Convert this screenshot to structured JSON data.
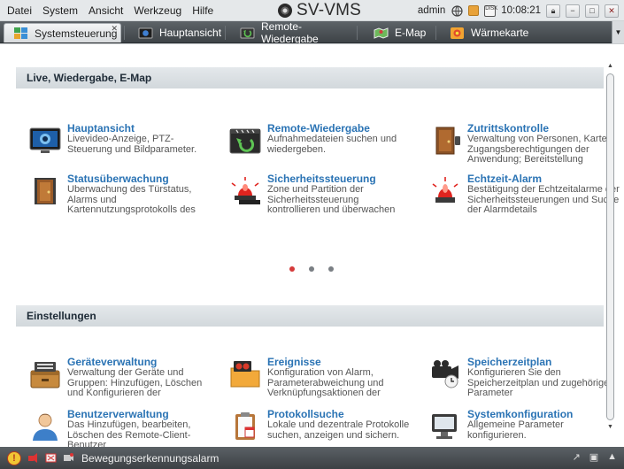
{
  "menu": [
    "Datei",
    "System",
    "Ansicht",
    "Werkzeug",
    "Hilfe"
  ],
  "app": {
    "title": "SV-VMS"
  },
  "user": {
    "name": "admin",
    "clock": "10:08:21",
    "disk_label": "DISK"
  },
  "tabs": [
    {
      "label": "Systemsteuerung",
      "icon": "control-panel-icon"
    },
    {
      "label": "Hauptansicht",
      "icon": "camera-icon"
    },
    {
      "label": "Remote-Wiedergabe",
      "icon": "playback-icon"
    },
    {
      "label": "E-Map",
      "icon": "map-icon"
    },
    {
      "label": "Wärmekarte",
      "icon": "heatmap-icon"
    }
  ],
  "sections": [
    {
      "title": "Live, Wiedergabe, E-Map",
      "cards": [
        {
          "title": "Hauptansicht",
          "desc": "Livevideo-Anzeige, PTZ-Steuerung und Bildparameter.",
          "icon": "monitor-icon"
        },
        {
          "title": "Remote-Wiedergabe",
          "desc": "Aufnahmedateien suchen und wiedergeben.",
          "icon": "playback-icon"
        },
        {
          "title": "Zutrittskontrolle",
          "desc": "Verwaltung von Personen, Karten, Zugangsberechtigungen der Anwendung; Bereitstellung",
          "icon": "door-icon"
        },
        {
          "title": "Statusüberwachung",
          "desc": "Überwachung des Türstatus, Alarms und Kartennutzungsprotokolls des",
          "icon": "door-status-icon"
        },
        {
          "title": "Sicherheitssteuerung",
          "desc": "Zone und Partition der Sicherheitssteuerung kontrollieren und überwachen",
          "icon": "alarm-siren-icon"
        },
        {
          "title": "Echtzeit-Alarm",
          "desc": "Bestätigung der Echtzeitalarme der Sicherheitssteuerungen und Suche der Alarmdetails",
          "icon": "alarm-light-icon"
        }
      ]
    },
    {
      "title": "Einstellungen",
      "cards": [
        {
          "title": "Geräteverwaltung",
          "desc": "Verwaltung der Geräte und Gruppen: Hinzufügen, Löschen und Konfigurieren der",
          "icon": "device-icon"
        },
        {
          "title": "Ereignisse",
          "desc": "Konfiguration von Alarm, Parameterabweichung und Verknüpfungsaktionen der",
          "icon": "event-folder-icon"
        },
        {
          "title": "Speicherzeitplan",
          "desc": "Konfigurieren Sie den Speicherzeitplan und zugehörige Parameter",
          "icon": "record-schedule-icon"
        },
        {
          "title": "Benutzerverwaltung",
          "desc": "Das Hinzufügen, bearbeiten, Löschen des Remote-Client-Benutzer",
          "icon": "user-icon"
        },
        {
          "title": "Protokollsuche",
          "desc": "Lokale und dezentrale Protokolle suchen, anzeigen und sichern.",
          "icon": "log-icon"
        },
        {
          "title": "Systemkonfiguration",
          "desc": "Allgemeine Parameter konfigurieren.",
          "icon": "system-config-icon"
        }
      ]
    }
  ],
  "carousel": {
    "pages": 3,
    "active": 1
  },
  "statusbar": {
    "text": "Bewegungserkennungsalarm"
  },
  "colors": {
    "accent": "#2a73b4",
    "tabbar": "#4a5055",
    "dot_active": "#d53a3a"
  }
}
